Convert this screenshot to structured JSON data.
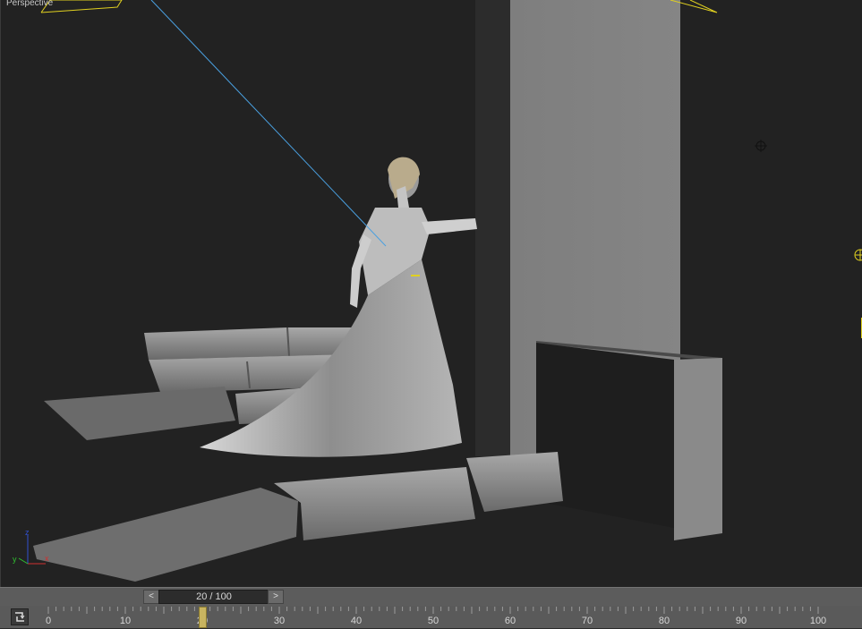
{
  "viewport": {
    "label": "Perspective"
  },
  "time_slider": {
    "frame_text": "20 / 100",
    "prev_glyph": "<",
    "next_glyph": ">",
    "current_frame": 20,
    "total_frames": 100
  },
  "timeline": {
    "labels": [
      "0",
      "10",
      "20",
      "30",
      "40",
      "50",
      "60",
      "70",
      "80",
      "90",
      "100"
    ],
    "key_mode_icon": "key-mode-toggle-icon"
  },
  "axis_gizmo": {
    "x": "x",
    "y": "y",
    "z": "z"
  },
  "colors": {
    "viewport_bg": "#222222",
    "camera_line": "#4aa0e0",
    "light_outline": "#e0d020",
    "time_marker": "#c8b460"
  }
}
